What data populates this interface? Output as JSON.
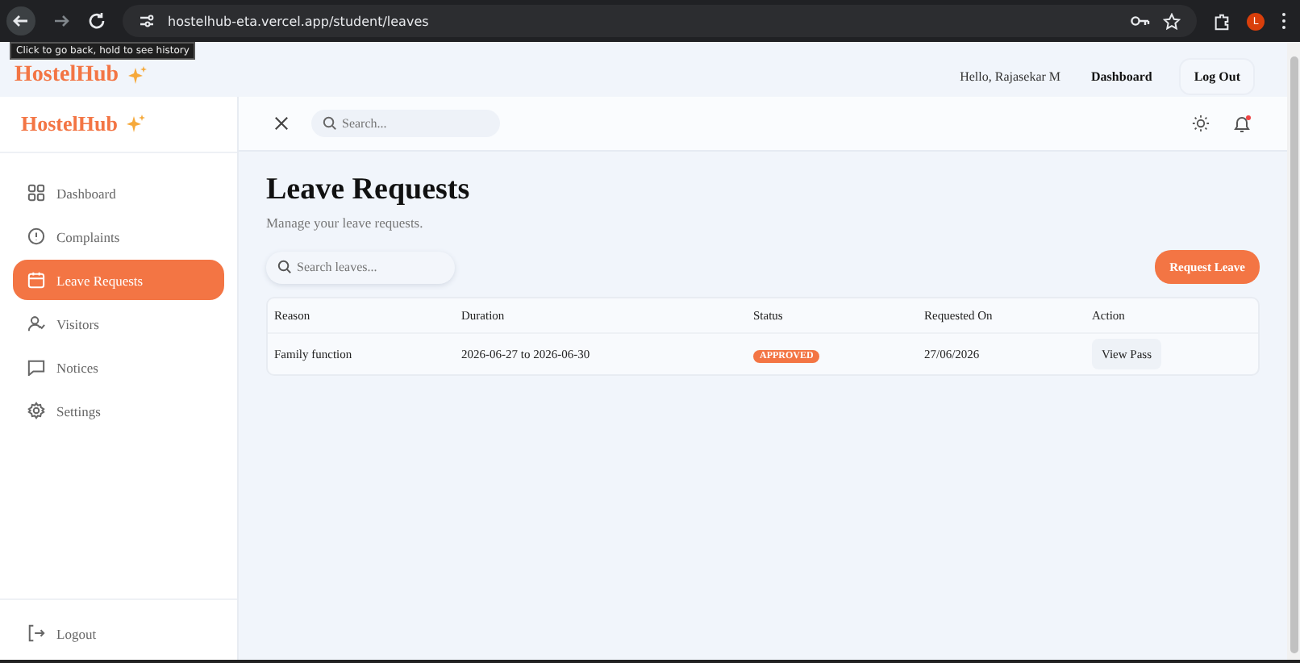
{
  "browser": {
    "url": "hostelhub-eta.vercel.app/student/leaves",
    "tooltip": "Click to go back, hold to see history",
    "profile_initial": "L"
  },
  "top_nav": {
    "logo": "HostelHub",
    "greeting": "Hello, Rajasekar M",
    "link": "Dashboard",
    "logout": "Log Out"
  },
  "sidebar": {
    "logo": "HostelHub",
    "items": [
      {
        "label": "Dashboard",
        "kind": "grid",
        "selected": false
      },
      {
        "label": "Complaints",
        "kind": "alert",
        "selected": false
      },
      {
        "label": "Leave Requests",
        "kind": "calendar",
        "selected": true
      },
      {
        "label": "Visitors",
        "kind": "user",
        "selected": false
      },
      {
        "label": "Notices",
        "kind": "message",
        "selected": false
      },
      {
        "label": "Settings",
        "kind": "gear",
        "selected": false
      }
    ],
    "logout": "Logout"
  },
  "header": {
    "search_placeholder": "Search...",
    "unread_notifications": true
  },
  "page": {
    "title": "Leave Requests",
    "subtitle": "Manage your leave requests.",
    "search_placeholder": "Search leaves...",
    "request_button": "Request Leave",
    "table": {
      "columns": [
        "Reason",
        "Duration",
        "Status",
        "Requested On",
        "Action"
      ],
      "rows": [
        {
          "reason": "Family function",
          "duration": "2026-06-27 to 2026-06-30",
          "status": "APPROVED",
          "requested_on": "27/06/2026",
          "action": "View Pass"
        }
      ]
    }
  }
}
